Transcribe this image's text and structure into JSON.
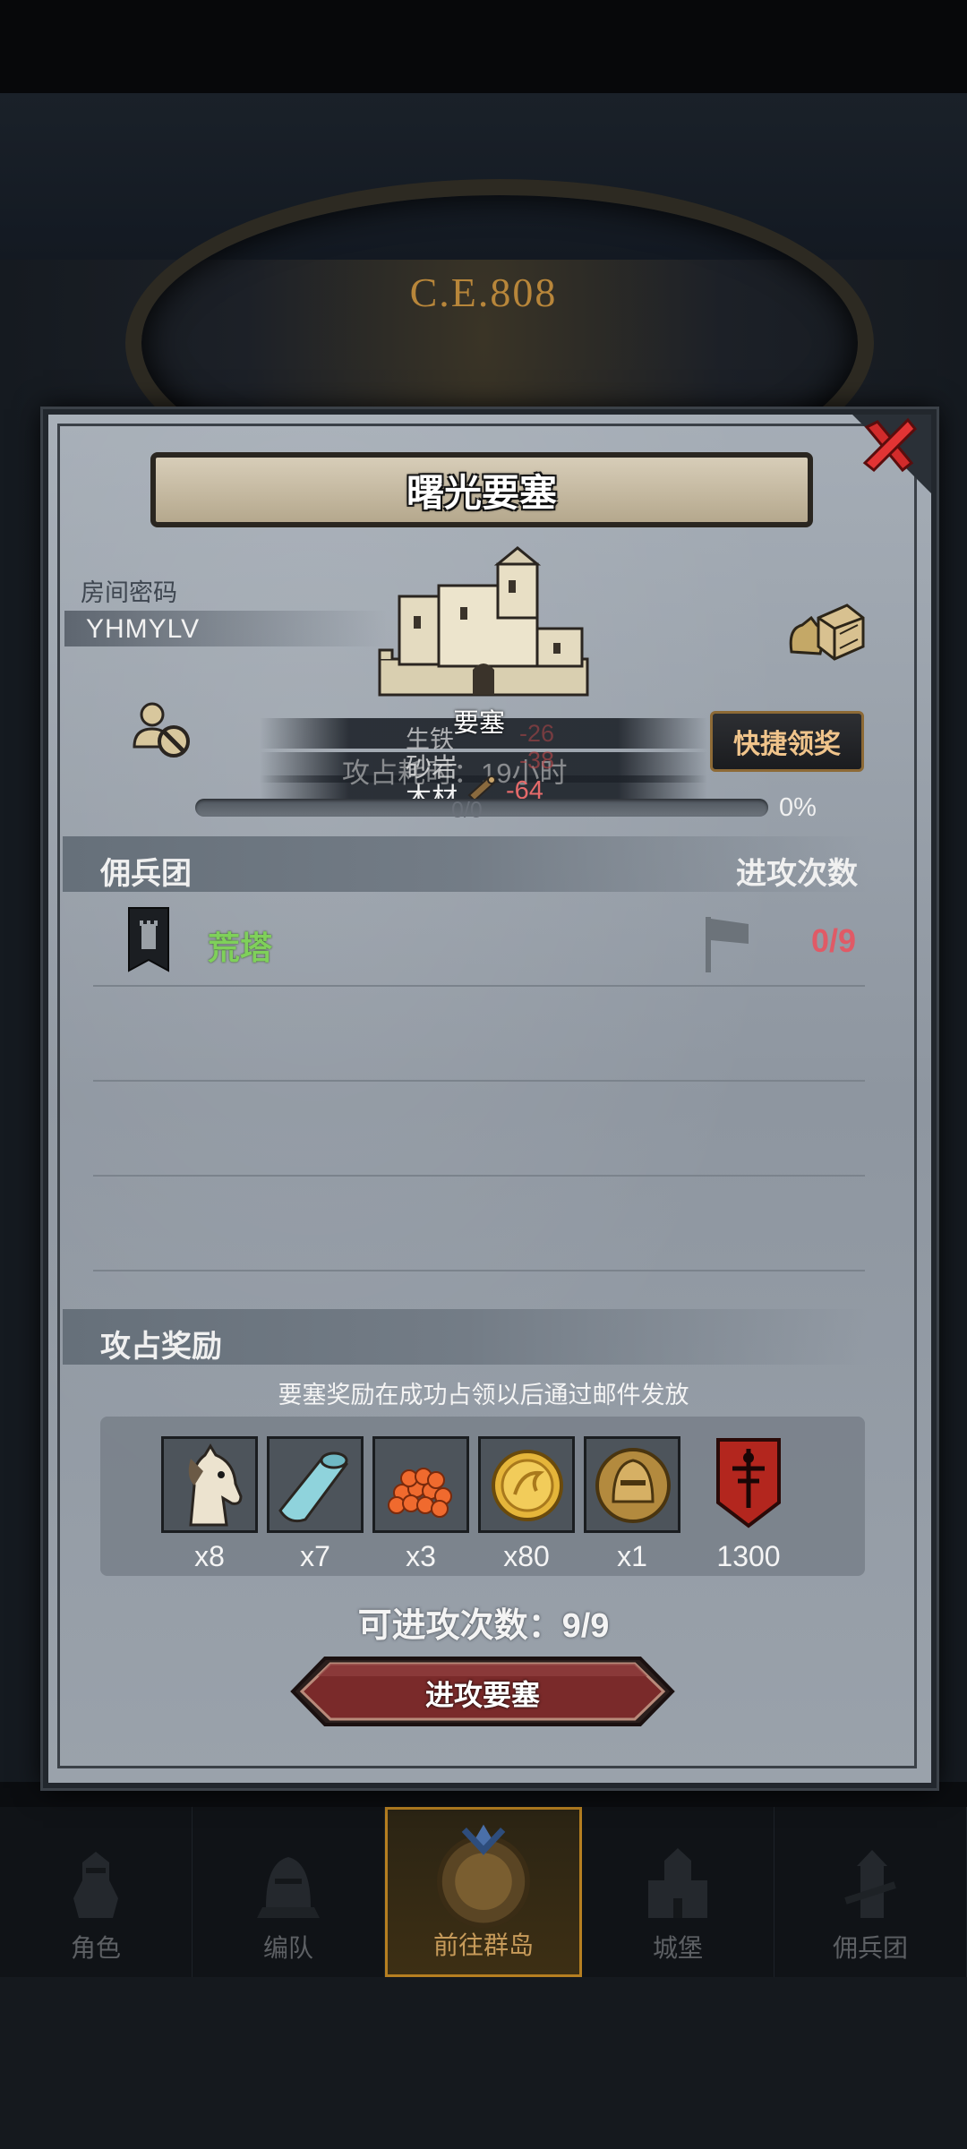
{
  "background": {
    "era_text": "C.E.808"
  },
  "dialog": {
    "title": "曙光要塞",
    "room_code_label": "房间密码",
    "room_code": "YHMYLV",
    "quick_claim_label": "快捷领奖",
    "fort_label": "要塞",
    "capture_time_text": "攻占耗时：19小时",
    "resources": [
      {
        "name": "生铁",
        "value": "-26"
      },
      {
        "name": "砂岩",
        "value": "-38"
      },
      {
        "name": "木材",
        "value": "-64"
      }
    ],
    "progress": {
      "count_text": "0/0",
      "percent_text": "0%",
      "fraction": 0.0
    },
    "mercenaries_header": "佣兵团",
    "attack_count_header": "进攻次数",
    "mercenaries": [
      {
        "name": "荒塔",
        "attacks": "0/9"
      }
    ],
    "rewards_header": "攻占奖励",
    "rewards_note": "要塞奖励在成功占领以后通过邮件发放",
    "rewards": [
      {
        "icon": "horse-icon",
        "qty": "x8"
      },
      {
        "icon": "cloth-roll-icon",
        "qty": "x7"
      },
      {
        "icon": "berries-icon",
        "qty": "x3"
      },
      {
        "icon": "gold-coin-icon",
        "qty": "x80"
      },
      {
        "icon": "helmet-medal-icon",
        "qty": "x1"
      },
      {
        "icon": "red-banner-icon",
        "qty": "1300"
      }
    ],
    "attack_times_text": "可进攻次数：9/9",
    "attack_button_label": "进攻要塞"
  },
  "bottom_nav": [
    {
      "label": "角色",
      "icon": "knight-icon",
      "active": false
    },
    {
      "label": "编队",
      "icon": "helmet-icon",
      "active": false
    },
    {
      "label": "前往群岛",
      "icon": "compass-icon",
      "active": true
    },
    {
      "label": "城堡",
      "icon": "castle-icon",
      "active": false
    },
    {
      "label": "佣兵团",
      "icon": "tower-icon",
      "active": false
    }
  ],
  "colors": {
    "accent_gold": "#b67f21",
    "merc_name_green": "#7fd05a",
    "attack_count_red": "#e05a66",
    "resource_negative": "#e46a6a"
  }
}
